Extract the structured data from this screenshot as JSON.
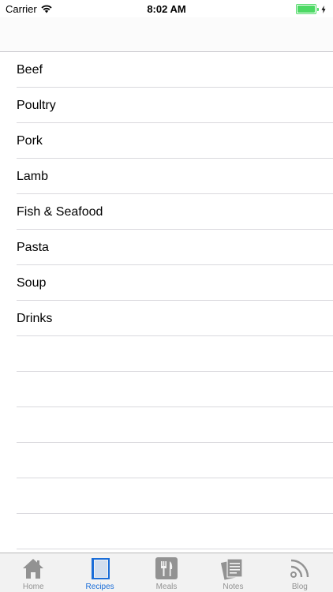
{
  "status_bar": {
    "carrier": "Carrier",
    "time": "8:02 AM",
    "battery_level": 1.0,
    "battery_color": "#4cd964"
  },
  "categories": [
    "Beef",
    "Poultry",
    "Pork",
    "Lamb",
    "Fish & Seafood",
    "Pasta",
    "Soup",
    "Drinks"
  ],
  "tab_bar": {
    "tabs": [
      {
        "label": "Home",
        "icon": "home-icon",
        "active": false
      },
      {
        "label": "Recipes",
        "icon": "book-icon",
        "active": true
      },
      {
        "label": "Meals",
        "icon": "fork-knife-icon",
        "active": false
      },
      {
        "label": "Notes",
        "icon": "notes-icon",
        "active": false
      },
      {
        "label": "Blog",
        "icon": "rss-icon",
        "active": false
      }
    ],
    "active_color": "#1a6dd8",
    "inactive_color": "#929292"
  }
}
